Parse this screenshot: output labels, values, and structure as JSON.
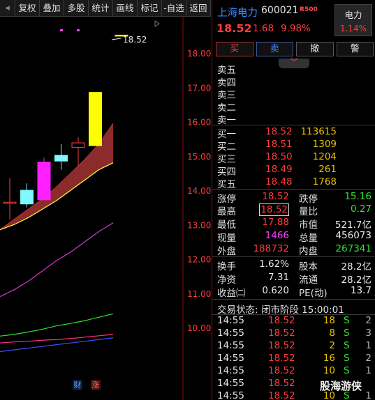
{
  "toolbar": {
    "items": [
      "复权",
      "叠加",
      "多股",
      "统计",
      "画线",
      "标记",
      "-自选",
      "返回"
    ]
  },
  "chart": {
    "price_labels": [
      "18.00",
      "17.00",
      "16.00",
      "15.00",
      "14.00",
      "13.00",
      "12.00",
      "11.00",
      "10.00"
    ],
    "high_label": "18.52",
    "markers": {
      "cai": "财",
      "zhang": "涨"
    },
    "colors": {
      "up_candle": "#ff3b3b",
      "down_candle": "#7ff8ff",
      "limit_candle": "#ffff00",
      "ma_band_fill": "#8b2b2b",
      "ma_upper": "#ffff40",
      "ma_magenta": "#d23ad2",
      "ma_green": "#2ee62e",
      "ma_pink": "#ff2f7a",
      "ma_blue": "#3f4fff"
    },
    "candles": [
      {
        "o": 13.65,
        "c": 13.65,
        "h": 14.35,
        "l": 13.15,
        "color": "red"
      },
      {
        "o": 14.0,
        "c": 13.6,
        "h": 14.2,
        "l": 13.5,
        "color": "cyan"
      },
      {
        "o": 13.72,
        "c": 14.82,
        "h": 14.95,
        "l": 13.72,
        "color": "magenta"
      },
      {
        "o": 15.02,
        "c": 14.85,
        "h": 15.35,
        "l": 14.6,
        "color": "cyan"
      },
      {
        "o": 15.25,
        "c": 15.38,
        "h": 15.55,
        "l": 14.7,
        "color": "red"
      },
      {
        "o": 15.3,
        "c": 16.85,
        "h": 16.85,
        "l": 15.3,
        "color": "yellow"
      },
      {
        "o": 18.52,
        "c": 18.52,
        "h": 18.52,
        "l": 18.52,
        "color": "yellow"
      }
    ],
    "ma_band": {
      "upper": [
        12.85,
        13.15,
        13.45,
        13.75,
        14.1,
        14.5,
        14.9,
        15.35,
        15.95
      ],
      "lower": [
        12.85,
        13.0,
        13.2,
        13.45,
        13.7,
        14.0,
        14.3,
        14.6,
        14.8
      ]
    },
    "ma_magenta": [
      10.9,
      11.1,
      11.35,
      11.65,
      11.95,
      12.2,
      12.5,
      12.8,
      13.05
    ],
    "ma_green": [
      9.75,
      9.8,
      9.87,
      9.95,
      10.05,
      10.12,
      10.2,
      10.3,
      10.4
    ],
    "ma_pink": [
      9.55,
      9.58,
      9.6,
      9.63,
      9.65,
      9.68,
      9.72,
      9.76,
      9.8
    ],
    "ma_blue": [
      9.3,
      9.35,
      9.4,
      9.45,
      9.5,
      9.55,
      9.6,
      9.65,
      9.7
    ]
  },
  "header": {
    "name": "上海电力",
    "code": "600021",
    "tag": "R500",
    "price": "18.52",
    "change": "1.68",
    "pct": "9.98%",
    "sector_name": "电力",
    "sector_pct": "1.14%"
  },
  "trade_buttons": [
    "买",
    "卖",
    "撤",
    "警"
  ],
  "sell_book": [
    {
      "label": "卖五",
      "price": "",
      "vol": ""
    },
    {
      "label": "卖四",
      "price": "",
      "vol": ""
    },
    {
      "label": "卖三",
      "price": "",
      "vol": ""
    },
    {
      "label": "卖二",
      "price": "",
      "vol": ""
    },
    {
      "label": "卖一",
      "price": "",
      "vol": ""
    }
  ],
  "buy_book": [
    {
      "label": "买一",
      "price": "18.52",
      "vol": "113615"
    },
    {
      "label": "买二",
      "price": "18.51",
      "vol": "1309"
    },
    {
      "label": "买三",
      "price": "18.50",
      "vol": "1204"
    },
    {
      "label": "买四",
      "price": "18.49",
      "vol": "261"
    },
    {
      "label": "买五",
      "price": "18.48",
      "vol": "1768"
    }
  ],
  "quote": {
    "zhangting": {
      "label": "涨停",
      "value": "18.52"
    },
    "dieting": {
      "label": "跌停",
      "value": "15.16"
    },
    "zuigao": {
      "label": "最高",
      "value": "18.52"
    },
    "liangbi": {
      "label": "量比",
      "value": "0.27"
    },
    "zuidi": {
      "label": "最低",
      "value": "17.88"
    },
    "shizhi": {
      "label": "市值",
      "value": "521.7亿"
    },
    "xianliang": {
      "label": "现量",
      "value": "1466"
    },
    "zongliang": {
      "label": "总量",
      "value": "456073"
    },
    "waipan": {
      "label": "外盘",
      "value": "188732"
    },
    "neipan": {
      "label": "内盘",
      "value": "267341"
    },
    "huanshou": {
      "label": "换手",
      "value": "1.62%"
    },
    "guben": {
      "label": "股本",
      "value": "28.2亿"
    },
    "jingzi": {
      "label": "净资",
      "value": "7.31"
    },
    "liutong": {
      "label": "流通",
      "value": "28.2亿"
    },
    "shouyi": {
      "label": "收益㈡",
      "value": "0.620"
    },
    "pe": {
      "label": "PE(动)",
      "value": "13.7"
    }
  },
  "status": "交易状态: 闭市阶段 15:00:01",
  "ticks": [
    {
      "time": "14:55",
      "price": "18.52",
      "vol": "18",
      "dir": "S",
      "num": "2"
    },
    {
      "time": "14:55",
      "price": "18.52",
      "vol": "8",
      "dir": "S",
      "num": "3"
    },
    {
      "time": "14:55",
      "price": "18.52",
      "vol": "2",
      "dir": "S",
      "num": "1"
    },
    {
      "time": "14:55",
      "price": "18.52",
      "vol": "16",
      "dir": "S",
      "num": "2"
    },
    {
      "time": "14:55",
      "price": "18.52",
      "vol": "10",
      "dir": "S",
      "num": "1"
    },
    {
      "time": "14:55",
      "price": "18.52",
      "vol": "",
      "dir": "",
      "num": ""
    },
    {
      "time": "14:55",
      "price": "18.52",
      "vol": "10",
      "dir": "S",
      "num": "1"
    }
  ],
  "watermark": "股海游侠"
}
